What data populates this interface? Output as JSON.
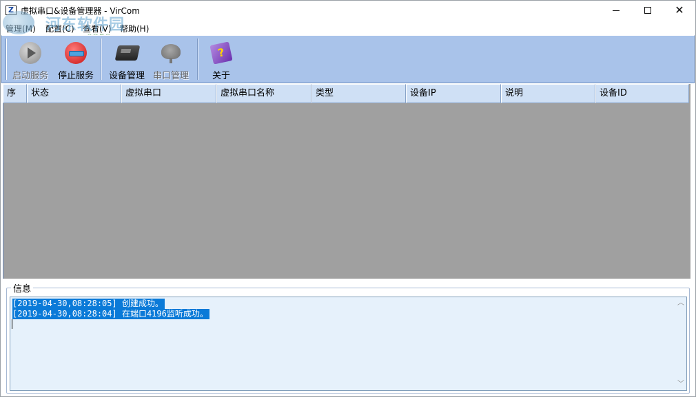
{
  "window": {
    "title": "虚拟串口&设备管理器 - VirCom",
    "icon_letter": "Z",
    "minimize_icon": "minimize-icon",
    "maximize_icon": "maximize-icon",
    "close_glyph": "✕"
  },
  "menu": {
    "items": [
      {
        "label": "管理(M)"
      },
      {
        "label": "配置(C)"
      },
      {
        "label": "查看(V)"
      },
      {
        "label": "帮助(H)"
      }
    ]
  },
  "watermark": {
    "title": "河东软件园",
    "url": "www.pc0359.cn"
  },
  "toolbar": {
    "buttons": [
      {
        "label": "启动服务",
        "icon": "play-icon",
        "enabled": false
      },
      {
        "label": "停止服务",
        "icon": "stop-icon",
        "enabled": true
      },
      {
        "label": "设备管理",
        "icon": "device-icon",
        "enabled": true
      },
      {
        "label": "串口管理",
        "icon": "serial-port-icon",
        "enabled": false
      },
      {
        "label": "关于",
        "icon": "about-book-icon",
        "enabled": true,
        "glyph": "?"
      }
    ]
  },
  "table": {
    "columns": [
      "序",
      "状态",
      "虚拟串口",
      "虚拟串口名称",
      "类型",
      "设备IP",
      "说明",
      "设备ID"
    ],
    "rows": []
  },
  "info": {
    "label": "信息",
    "log": [
      "[2019-04-30,08:28:05] 创建成功。",
      "[2019-04-30,08:28:04] 在端口4196监听成功。"
    ]
  },
  "colors": {
    "toolbar_bg": "#a9c3ea",
    "header_bg": "#cfe0f5",
    "grid_bg": "#a0a0a0",
    "log_bg": "#e6f1fb",
    "selection": "#0a7ad8"
  }
}
